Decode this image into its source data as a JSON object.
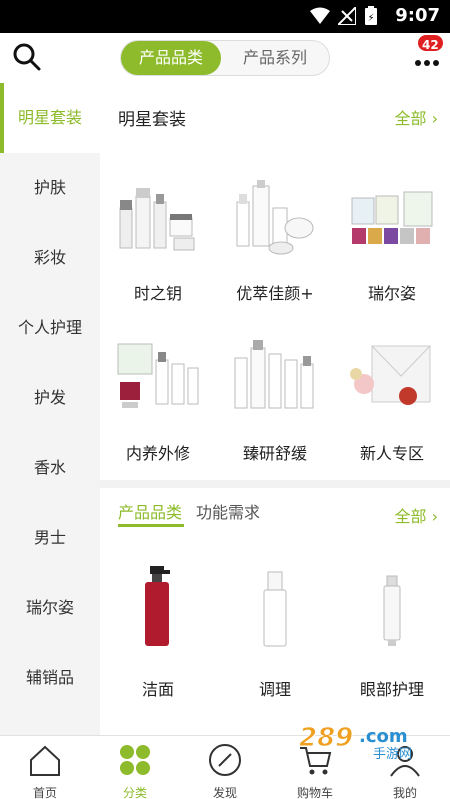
{
  "status": {
    "time": "9:07"
  },
  "header": {
    "tabs": [
      "产品品类",
      "产品系列"
    ],
    "badge_count": "42"
  },
  "sidebar": {
    "items": [
      "明星套装",
      "护肤",
      "彩妆",
      "个人护理",
      "护发",
      "香水",
      "男士",
      "瑞尔姿",
      "辅销品"
    ]
  },
  "section1": {
    "title": "明星套装",
    "all_label": "全部",
    "products": [
      "时之钥",
      "优萃佳颜+",
      "瑞尔姿",
      "内养外修",
      "臻研舒缓",
      "新人专区"
    ]
  },
  "section2": {
    "tabs": [
      "产品品类",
      "功能需求"
    ],
    "all_label": "全部",
    "products": [
      "洁面",
      "调理",
      "眼部护理"
    ]
  },
  "bottom_nav": {
    "items": [
      "首页",
      "分类",
      "发现",
      "购物车",
      "我的"
    ]
  },
  "watermark_text": "289.com 手游网",
  "colors": {
    "accent": "#8dbb2b",
    "badge": "#e02020"
  }
}
